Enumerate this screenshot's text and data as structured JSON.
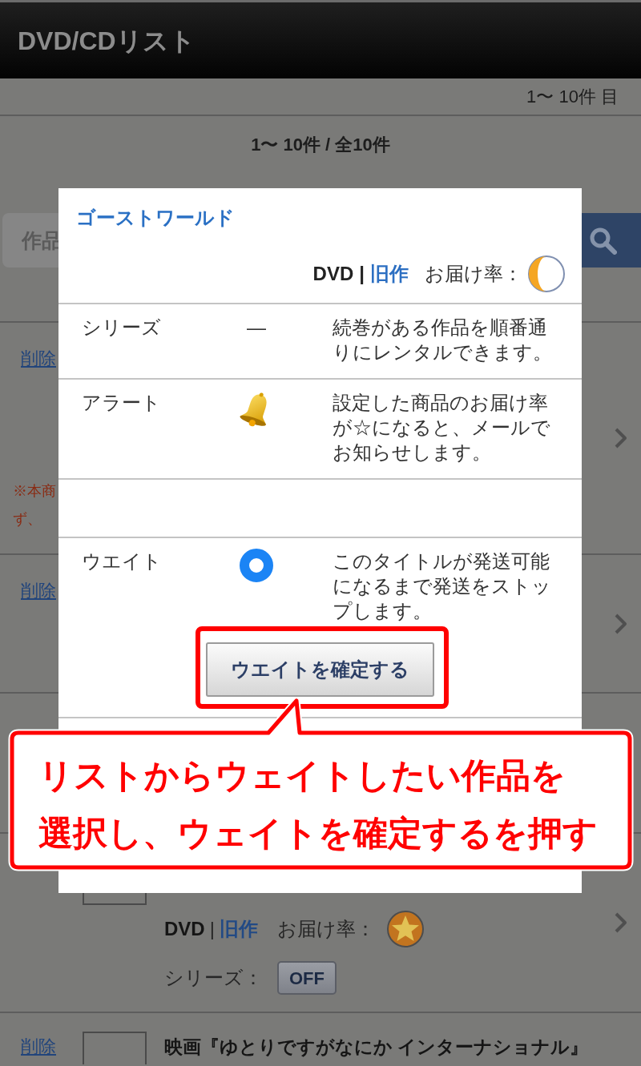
{
  "header": {
    "title": "DVD/CDリスト"
  },
  "pager": {
    "range": "1〜 10件 目",
    "summary": "1〜 10件 / 全10件"
  },
  "search": {
    "placeholder": "作品"
  },
  "list_items": [
    {
      "kind": "note",
      "delete_link": "削除",
      "note_lines": [
        "※本商",
        "ず、"
      ],
      "chevron": true
    },
    {
      "kind": "link",
      "delete_link": "削除",
      "chevron": true
    },
    {
      "kind": "covered",
      "chevron": false
    },
    {
      "kind": "details",
      "format": "DVD",
      "separator": "|",
      "category": "旧作",
      "delivery": {
        "label": "お届け率：",
        "kind": "full"
      },
      "series_label": "シリーズ：",
      "series_toggle": "OFF",
      "chevron": true
    },
    {
      "kind": "title",
      "delete_link": "削除",
      "title": "映画『ゆとりですがなにか インターナショナル』",
      "chevron": false
    }
  ],
  "modal": {
    "title": "ゴーストワールド",
    "format": "DVD",
    "separator": "|",
    "category": "旧作",
    "delivery": {
      "label": "お届け率：",
      "kind": "half"
    },
    "options": [
      {
        "kind": "symbol",
        "label": "シリーズ",
        "symbol": "—",
        "description": "続巻がある作品を順番通りにレンタルできます。"
      },
      {
        "kind": "bell",
        "label": "アラート",
        "description": "設定した商品のお届け率が☆になると、メールでお知らせします。"
      },
      {
        "kind": "blank"
      },
      {
        "kind": "radio",
        "label": "ウエイト",
        "checked": true,
        "description": "このタイトルが発送可能になるまで発送をストップします。"
      }
    ],
    "confirm_button": "ウエイトを確定する"
  },
  "annotation": {
    "highlight": true,
    "callout_lines": [
      "リストからウェイトしたい作品を",
      "選択し、ウェイトを確定するを押す"
    ]
  }
}
